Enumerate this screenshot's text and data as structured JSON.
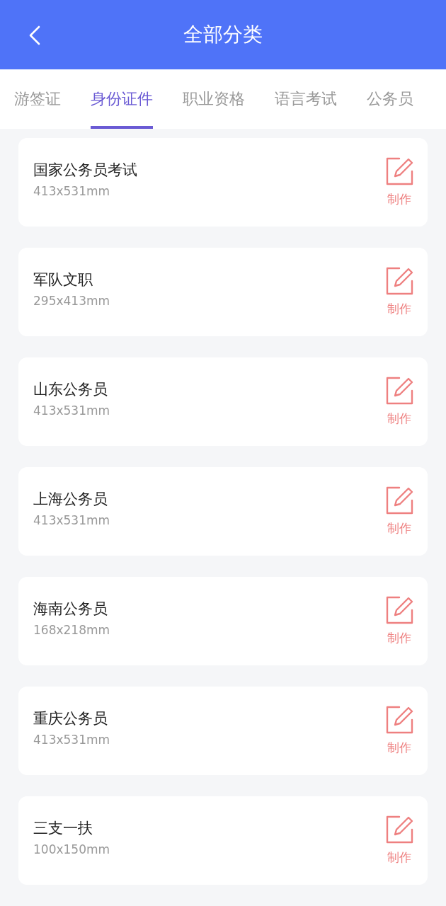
{
  "header": {
    "title": "全部分类"
  },
  "tabs": [
    {
      "label": "游签证",
      "selected": false
    },
    {
      "label": "身份证件",
      "selected": true
    },
    {
      "label": "职业资格",
      "selected": false
    },
    {
      "label": "语言考试",
      "selected": false
    },
    {
      "label": "公务员",
      "selected": false
    }
  ],
  "items": [
    {
      "name": "国家公务员考试",
      "size": "413x531mm",
      "action": "制作"
    },
    {
      "name": "军队文职",
      "size": "295x413mm",
      "action": "制作"
    },
    {
      "name": "山东公务员",
      "size": "413x531mm",
      "action": "制作"
    },
    {
      "name": "上海公务员",
      "size": "413x531mm",
      "action": "制作"
    },
    {
      "name": "海南公务员",
      "size": "168x218mm",
      "action": "制作"
    },
    {
      "name": "重庆公务员",
      "size": "413x531mm",
      "action": "制作"
    },
    {
      "name": "三支一扶",
      "size": "100x150mm",
      "action": "制作"
    }
  ]
}
